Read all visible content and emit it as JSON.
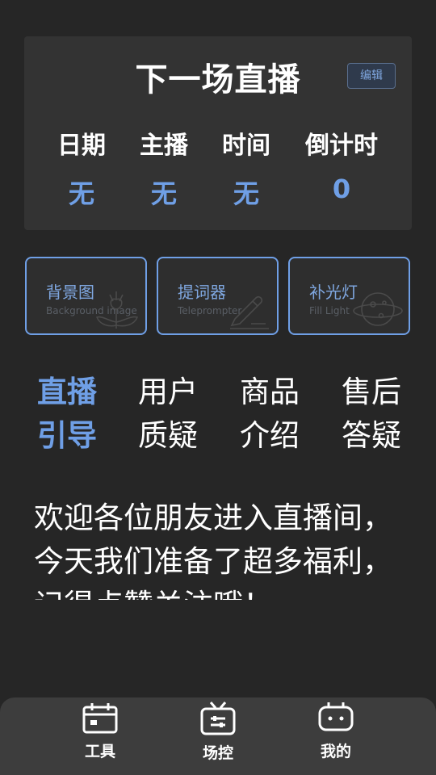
{
  "next_live": {
    "title": "下一场直播",
    "edit_label": "编辑",
    "columns": [
      {
        "label": "日期",
        "value": "无"
      },
      {
        "label": "主播",
        "value": "无"
      },
      {
        "label": "时间",
        "value": "无"
      },
      {
        "label": "倒计时",
        "value": "0"
      }
    ]
  },
  "tools": [
    {
      "title": "背景图",
      "subtitle": "Background image",
      "icon": "flower-icon"
    },
    {
      "title": "提词器",
      "subtitle": "Teleprompter",
      "icon": "pen-icon"
    },
    {
      "title": "补光灯",
      "subtitle": "Fill Light",
      "icon": "planet-icon"
    }
  ],
  "script_tabs": [
    {
      "line1": "直播",
      "line2": "引导",
      "active": true
    },
    {
      "line1": "用户",
      "line2": "质疑",
      "active": false
    },
    {
      "line1": "商品",
      "line2": "介绍",
      "active": false
    },
    {
      "line1": "售后",
      "line2": "答疑",
      "active": false
    }
  ],
  "script_text": [
    "欢迎各位朋友进入直播间，",
    "今天我们准备了超多福利，",
    "记得点赞关注哦！"
  ],
  "bottom_nav": [
    {
      "label": "工具",
      "icon": "calendar-icon"
    },
    {
      "label": "场控",
      "icon": "tv-sliders-icon"
    },
    {
      "label": "我的",
      "icon": "robot-face-icon"
    }
  ],
  "colors": {
    "accent": "#6f9fe6",
    "background": "#262626",
    "card": "#333333",
    "nav_bar": "#3d3d3d"
  }
}
